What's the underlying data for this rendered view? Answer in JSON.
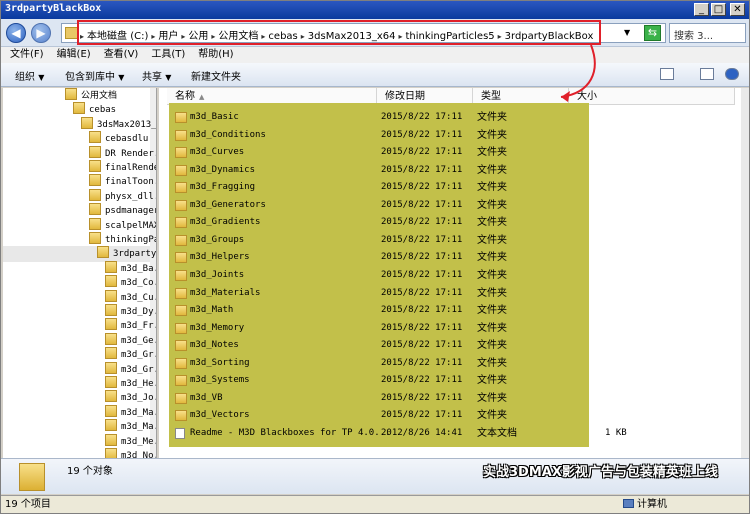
{
  "window": {
    "title": "3rdpartyBlackBox"
  },
  "title_buttons": {
    "minimize": "_",
    "maximize": "□",
    "close": "✕"
  },
  "nav": {
    "back_icon": "arrow-left-icon",
    "forward_icon": "arrow-right-icon"
  },
  "address": {
    "crumbs": [
      "本地磁盘 (C:)",
      "用户",
      "公用",
      "公用文档",
      "cebas",
      "3dsMax2013_x64",
      "thinkingParticles5",
      "3rdpartyBlackBox"
    ],
    "highlight_color": "#e0202a"
  },
  "search": {
    "placeholder": "搜索 3..."
  },
  "menu": [
    "文件(F)",
    "编辑(E)",
    "查看(V)",
    "工具(T)",
    "帮助(H)"
  ],
  "toolbar": {
    "organize": "组织",
    "include_in_library": "包含到库中",
    "share": "共享",
    "new_folder": "新建文件夹"
  },
  "tree": [
    {
      "label": "公用文档",
      "level": 0
    },
    {
      "label": "cebas",
      "level": 1
    },
    {
      "label": "3dsMax2013_...",
      "level": 2
    },
    {
      "label": "cebasdlu",
      "level": 3
    },
    {
      "label": "DR Render...",
      "level": 3
    },
    {
      "label": "finalRende...",
      "level": 3
    },
    {
      "label": "finalToon...",
      "level": 3
    },
    {
      "label": "physx_dll...",
      "level": 3
    },
    {
      "label": "psdmanager",
      "level": 3
    },
    {
      "label": "scalpelMAX",
      "level": 3
    },
    {
      "label": "thinkingPa...",
      "level": 3
    },
    {
      "label": "3rdparty...",
      "level": 4,
      "selected": true
    },
    {
      "label": "m3d_Ba...",
      "level": 5
    },
    {
      "label": "m3d_Co...",
      "level": 5
    },
    {
      "label": "m3d_Cu...",
      "level": 5
    },
    {
      "label": "m3d_Dy...",
      "level": 5
    },
    {
      "label": "m3d_Fr...",
      "level": 5
    },
    {
      "label": "m3d_Ge...",
      "level": 5
    },
    {
      "label": "m3d_Gr...",
      "level": 5
    },
    {
      "label": "m3d_Gr...",
      "level": 5
    },
    {
      "label": "m3d_He...",
      "level": 5
    },
    {
      "label": "m3d_Jo...",
      "level": 5
    },
    {
      "label": "m3d_Ma...",
      "level": 5
    },
    {
      "label": "m3d_Ma...",
      "level": 5
    },
    {
      "label": "m3d_Me...",
      "level": 5
    },
    {
      "label": "m3d_No...",
      "level": 5
    }
  ],
  "columns": {
    "name": "名称",
    "date": "修改日期",
    "type": "类型",
    "size": "大小"
  },
  "files": [
    {
      "name": "m3d_Basic",
      "date": "2015/8/22 17:11",
      "type": "文件夹",
      "size": ""
    },
    {
      "name": "m3d_Conditions",
      "date": "2015/8/22 17:11",
      "type": "文件夹",
      "size": ""
    },
    {
      "name": "m3d_Curves",
      "date": "2015/8/22 17:11",
      "type": "文件夹",
      "size": ""
    },
    {
      "name": "m3d_Dynamics",
      "date": "2015/8/22 17:11",
      "type": "文件夹",
      "size": ""
    },
    {
      "name": "m3d_Fragging",
      "date": "2015/8/22 17:11",
      "type": "文件夹",
      "size": ""
    },
    {
      "name": "m3d_Generators",
      "date": "2015/8/22 17:11",
      "type": "文件夹",
      "size": ""
    },
    {
      "name": "m3d_Gradients",
      "date": "2015/8/22 17:11",
      "type": "文件夹",
      "size": ""
    },
    {
      "name": "m3d_Groups",
      "date": "2015/8/22 17:11",
      "type": "文件夹",
      "size": ""
    },
    {
      "name": "m3d_Helpers",
      "date": "2015/8/22 17:11",
      "type": "文件夹",
      "size": ""
    },
    {
      "name": "m3d_Joints",
      "date": "2015/8/22 17:11",
      "type": "文件夹",
      "size": ""
    },
    {
      "name": "m3d_Materials",
      "date": "2015/8/22 17:11",
      "type": "文件夹",
      "size": ""
    },
    {
      "name": "m3d_Math",
      "date": "2015/8/22 17:11",
      "type": "文件夹",
      "size": ""
    },
    {
      "name": "m3d_Memory",
      "date": "2015/8/22 17:11",
      "type": "文件夹",
      "size": ""
    },
    {
      "name": "m3d_Notes",
      "date": "2015/8/22 17:11",
      "type": "文件夹",
      "size": ""
    },
    {
      "name": "m3d_Sorting",
      "date": "2015/8/22 17:11",
      "type": "文件夹",
      "size": ""
    },
    {
      "name": "m3d_Systems",
      "date": "2015/8/22 17:11",
      "type": "文件夹",
      "size": ""
    },
    {
      "name": "m3d_VB",
      "date": "2015/8/22 17:11",
      "type": "文件夹",
      "size": ""
    },
    {
      "name": "m3d_Vectors",
      "date": "2015/8/22 17:11",
      "type": "文件夹",
      "size": ""
    },
    {
      "name": "Readme - M3D Blackboxes for TP 4.0...",
      "date": "2012/8/26 14:41",
      "type": "文本文档",
      "size": "1 KB",
      "is_text": true
    }
  ],
  "highlight_fill": "#c2c04a",
  "details": {
    "count": "19 个对象"
  },
  "banner": "实战3DMAX影视广告与包装精英班上线",
  "status": {
    "items": "19 个项目",
    "location": "计算机"
  }
}
